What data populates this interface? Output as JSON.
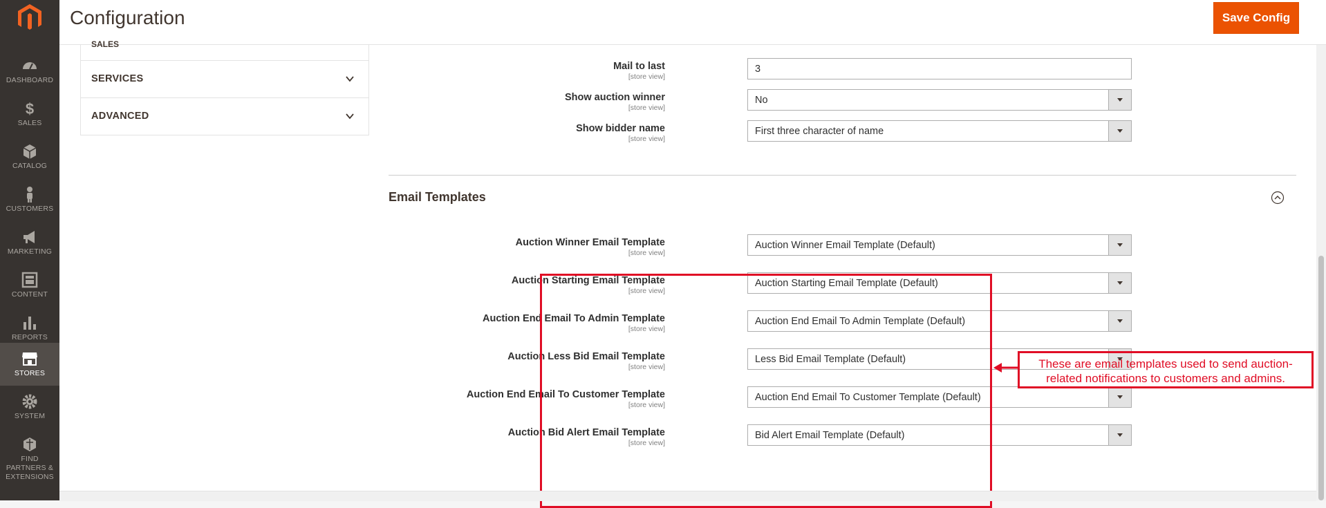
{
  "header": {
    "title": "Configuration",
    "save_label": "Save Config"
  },
  "nav": {
    "items": [
      {
        "label": "DASHBOARD",
        "icon": "dashboard-icon"
      },
      {
        "label": "SALES",
        "icon": "dollar-icon"
      },
      {
        "label": "CATALOG",
        "icon": "box-icon"
      },
      {
        "label": "CUSTOMERS",
        "icon": "person-icon"
      },
      {
        "label": "MARKETING",
        "icon": "megaphone-icon"
      },
      {
        "label": "CONTENT",
        "icon": "layout-icon"
      },
      {
        "label": "REPORTS",
        "icon": "bar-chart-icon"
      },
      {
        "label": "STORES",
        "icon": "storefront-icon",
        "active": true
      },
      {
        "label": "SYSTEM",
        "icon": "gear-icon"
      },
      {
        "label": "FIND PARTNERS & EXTENSIONS",
        "icon": "blocks-icon"
      }
    ]
  },
  "tabs": {
    "partial": "SALES",
    "items": [
      "SERVICES",
      "ADVANCED"
    ]
  },
  "fields_top": [
    {
      "label": "Mail to last",
      "scope": "[store view]",
      "value": "3",
      "type": "text"
    },
    {
      "label": "Show auction winner",
      "scope": "[store view]",
      "value": "No",
      "type": "select"
    },
    {
      "label": "Show bidder name",
      "scope": "[store view]",
      "value": "First three character of name",
      "type": "select"
    }
  ],
  "email_section": {
    "title": "Email Templates",
    "fields": [
      {
        "label": "Auction Winner Email Template",
        "scope": "[store view]",
        "value": "Auction Winner Email Template (Default)"
      },
      {
        "label": "Auction Starting Email Template",
        "scope": "[store view]",
        "value": "Auction Starting Email Template (Default)"
      },
      {
        "label": "Auction End Email To Admin Template",
        "scope": "[store view]",
        "value": "Auction End Email To Admin Template (Default)"
      },
      {
        "label": "Auction Less Bid Email Template",
        "scope": "[store view]",
        "value": "Less Bid Email Template (Default)"
      },
      {
        "label": "Auction End Email To Customer Template",
        "scope": "[store view]",
        "value": "Auction End Email To Customer Template (Default)"
      },
      {
        "label": "Auction Bid Alert Email Template",
        "scope": "[store view]",
        "value": "Bid Alert Email Template (Default)"
      }
    ]
  },
  "annotation": {
    "line1": "These are email templates used to send auction-",
    "line2": "related notifications to customers and admins.",
    "color": "#e00d25"
  },
  "colors": {
    "accent": "#eb5202",
    "nav_bg": "#373330",
    "annotation": "#e00d25"
  }
}
